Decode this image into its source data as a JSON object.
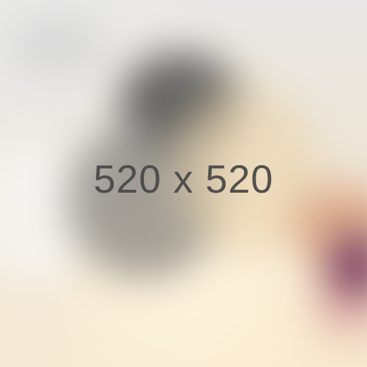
{
  "placeholder": {
    "label": "520 x 520"
  },
  "colors": {
    "label_text": "#4a4a4a",
    "background_base": "#efe8dc",
    "accent_orange": "#d79a78",
    "accent_purple": "#6a2d56",
    "dark_blur": "#4f4f4f"
  }
}
